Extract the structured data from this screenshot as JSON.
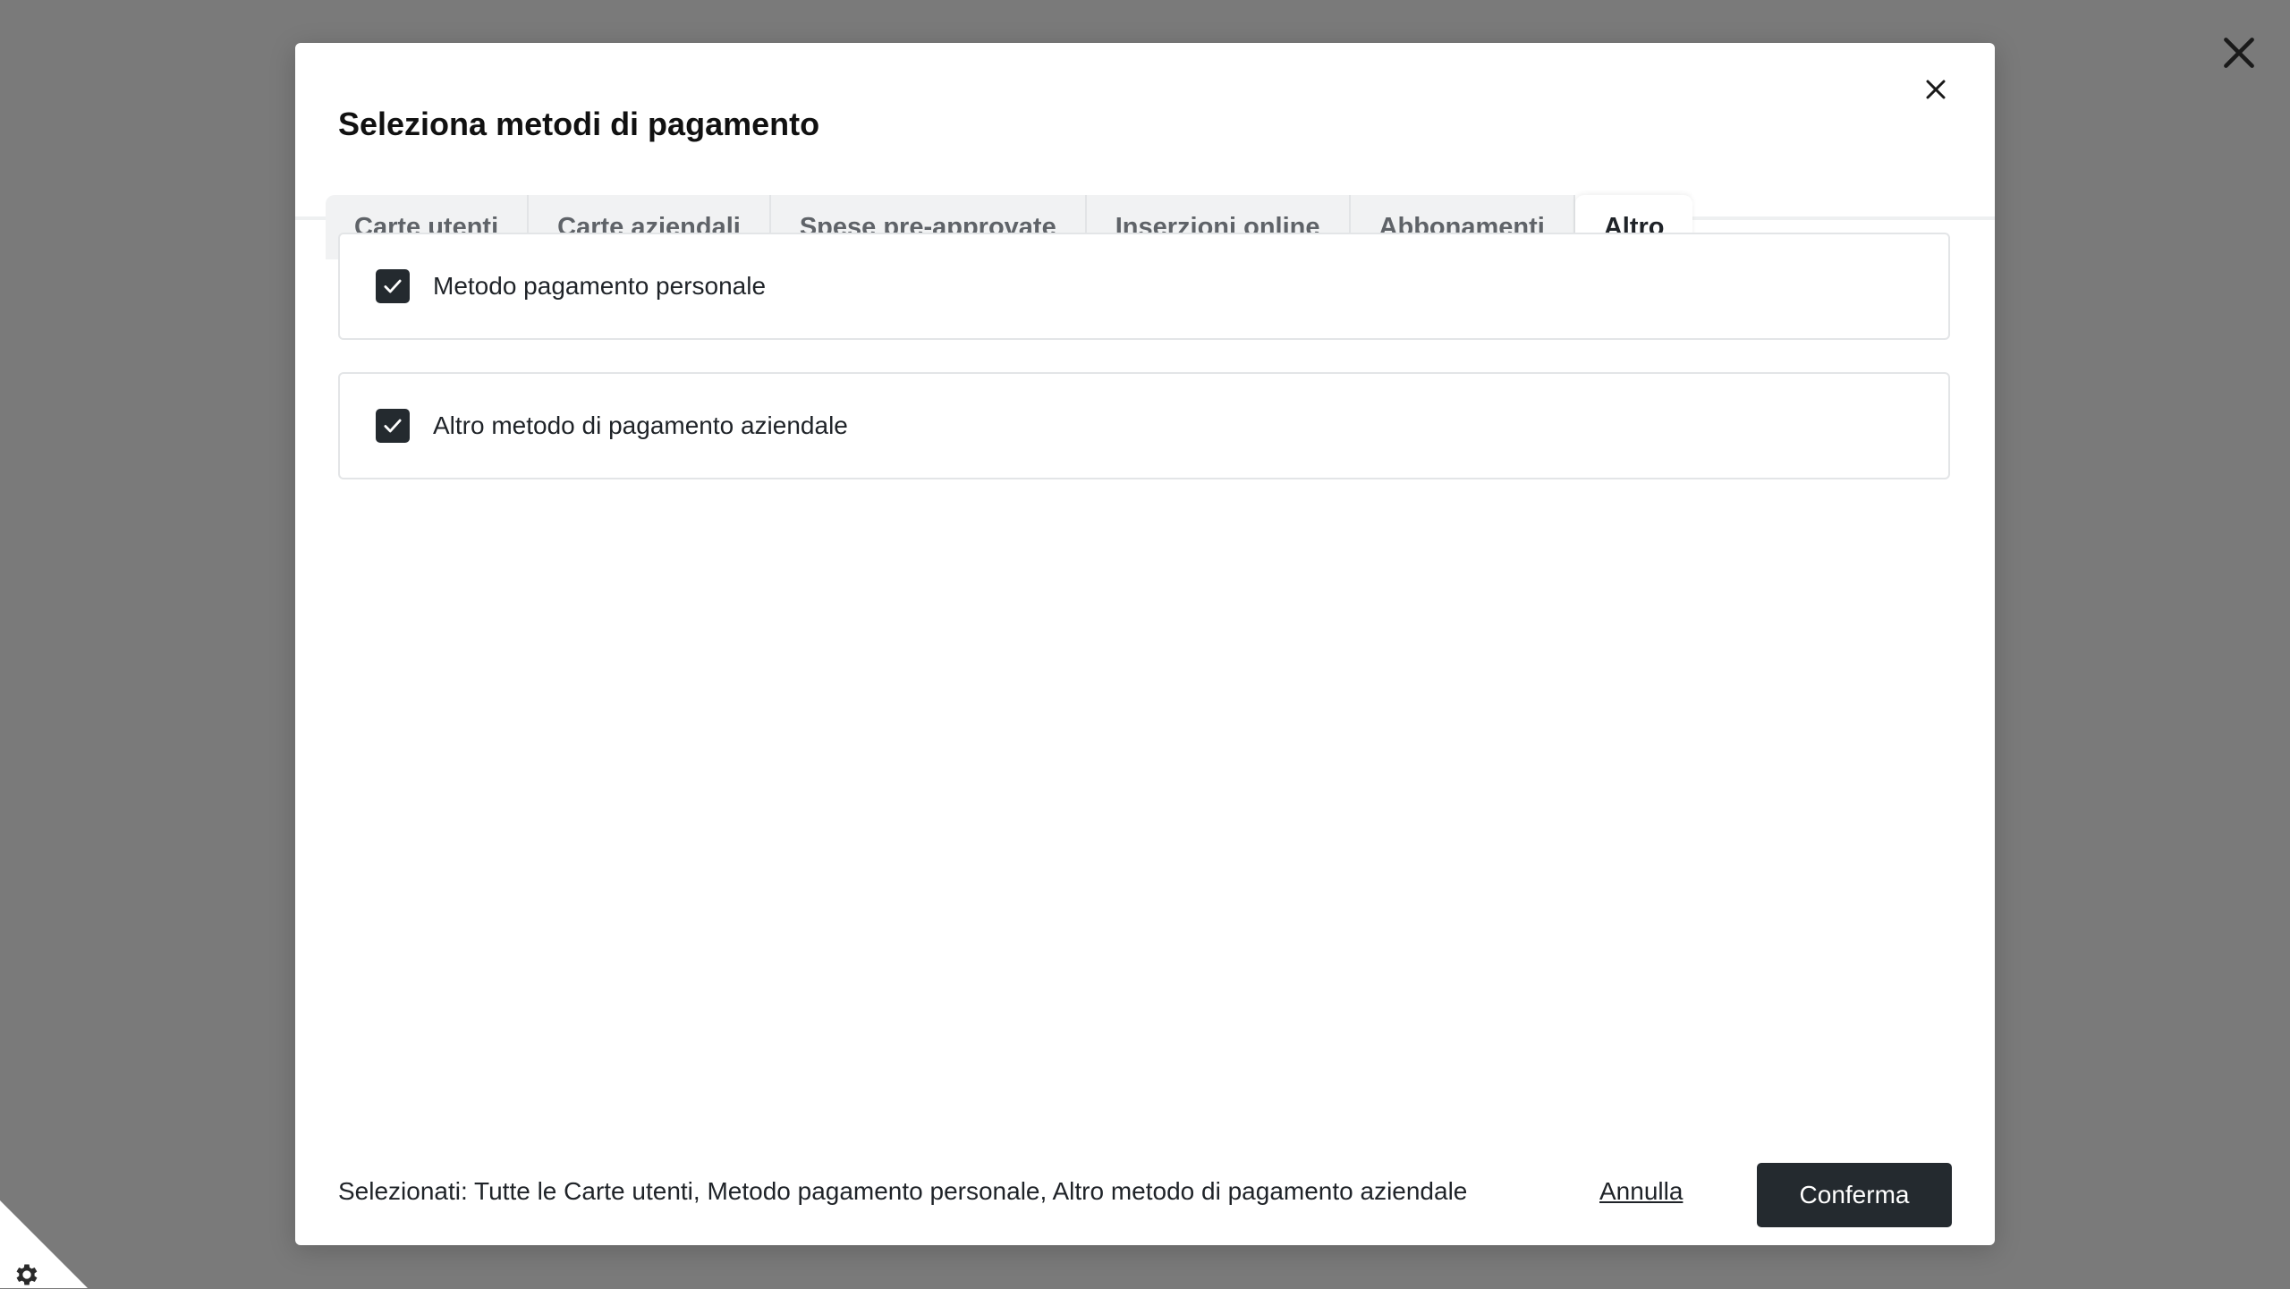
{
  "dialog": {
    "title": "Seleziona metodi di pagamento"
  },
  "tabs": [
    {
      "label": "Carte utenti",
      "active": false
    },
    {
      "label": "Carte aziendali",
      "active": false
    },
    {
      "label": "Spese pre-approvate",
      "active": false
    },
    {
      "label": "Inserzioni online",
      "active": false
    },
    {
      "label": "Abbonamenti",
      "active": false
    },
    {
      "label": "Altro",
      "active": true
    }
  ],
  "options": [
    {
      "label": "Metodo pagamento personale",
      "checked": true
    },
    {
      "label": "Altro metodo di pagamento aziendale",
      "checked": true
    }
  ],
  "footer": {
    "selected_text": "Selezionati: Tutte le Carte utenti, Metodo pagamento personale, Altro metodo di pagamento aziendale",
    "cancel_label": "Annulla",
    "confirm_label": "Conferma"
  },
  "icons": {
    "overlay_close": "close-icon",
    "dialog_close": "close-icon",
    "checkbox": "checkmark-icon",
    "settings": "gear-icon"
  },
  "colors": {
    "backdrop": "#7a7a7a",
    "primary_dark": "#242a2f",
    "tab_inactive_bg": "#f1f2f3"
  }
}
